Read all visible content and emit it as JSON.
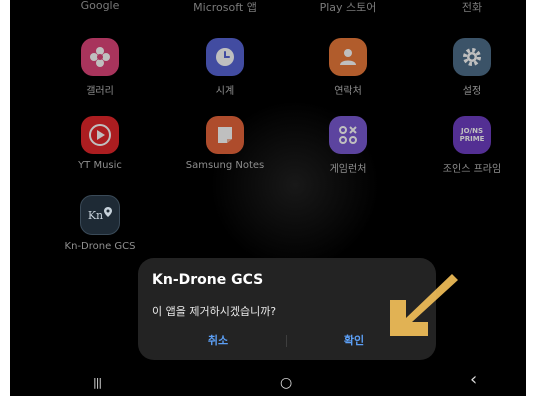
{
  "top_row": [
    {
      "label": "Google"
    },
    {
      "label": "Microsoft 앱"
    },
    {
      "label": "Play 스토어"
    },
    {
      "label": "전화"
    }
  ],
  "apps_row1": [
    {
      "label": "갤러리",
      "icon": "flower-icon",
      "color": "#e0457b"
    },
    {
      "label": "시계",
      "icon": "clock-icon",
      "color": "#5865d6"
    },
    {
      "label": "연락처",
      "icon": "person-icon",
      "color": "#ec7a3a"
    },
    {
      "label": "설정",
      "icon": "gear-icon",
      "color": "#4f6f8a"
    }
  ],
  "apps_row2": [
    {
      "label": "YT Music",
      "icon": "play-icon",
      "color": "#e5262a"
    },
    {
      "label": "Samsung Notes",
      "icon": "notes-icon",
      "color": "#e8663b"
    },
    {
      "label": "게임런처",
      "icon": "game-icon",
      "color": "#7b5bd4"
    },
    {
      "label": "조인스 프라임",
      "icon": "joins-prime-icon",
      "color": "#6f3fc4",
      "icon_text": "JO/NS PRIME"
    }
  ],
  "apps_row3": [
    {
      "label": "Kn-Drone GCS",
      "icon": "kn-drone-icon",
      "color": "#1e2a35",
      "icon_text": "Kn"
    }
  ],
  "dialog": {
    "title": "Kn-Drone GCS",
    "message": "이 앱을 제거하시겠습니까?",
    "cancel_label": "취소",
    "confirm_label": "확인"
  },
  "colors": {
    "dialog_bg": "#232323",
    "dialog_button": "#5c9ff5",
    "arrow": "#f6c25a"
  },
  "nav": {
    "recent": "|||",
    "home": "○",
    "back": "‹"
  }
}
